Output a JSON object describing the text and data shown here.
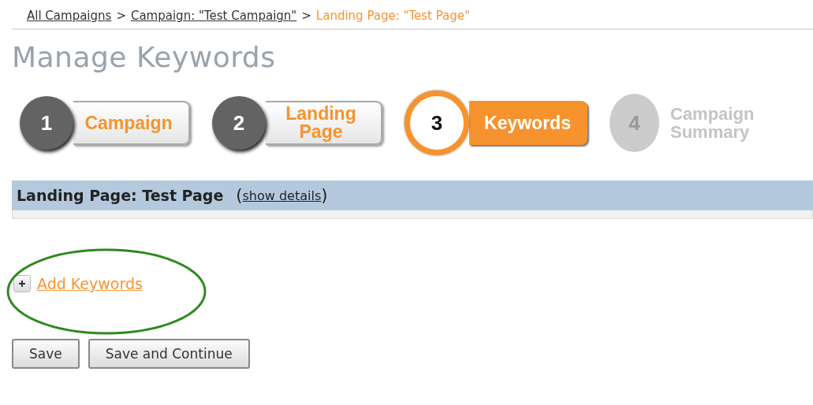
{
  "breadcrumb": [
    {
      "label": "All Campaigns",
      "kind": "link"
    },
    {
      "label": ">",
      "kind": "separator"
    },
    {
      "label": "Campaign: \"Test Campaign\"",
      "kind": "link"
    },
    {
      "label": ">",
      "kind": "separator"
    },
    {
      "label": "Landing Page: \"Test Page\"",
      "kind": "current"
    }
  ],
  "title": "Manage Keywords",
  "steps": [
    {
      "number": "1",
      "label": "Campaign",
      "selected": false,
      "disabled": false
    },
    {
      "number": "2",
      "label": "Landing Page",
      "selected": false,
      "disabled": false
    },
    {
      "number": "3",
      "label": "Keywords",
      "selected": true,
      "disabled": false
    },
    {
      "number": "4",
      "label": "Campaign Summary",
      "selected": false,
      "disabled": true
    }
  ],
  "section": {
    "title": "Landing Page: Test Page",
    "open_paren": "(",
    "link": "show details",
    "close_paren": ")"
  },
  "add_link": "Add Keywords",
  "buttons": [
    "Save",
    "Save and Continue"
  ]
}
